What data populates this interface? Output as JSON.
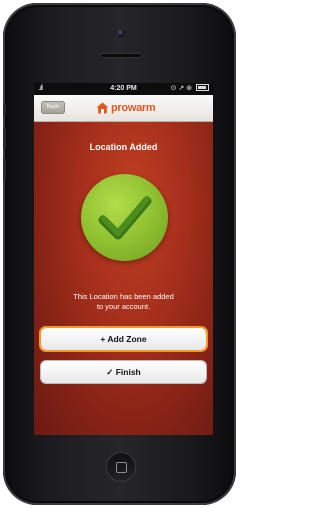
{
  "statusbar": {
    "signal": "..ıll",
    "time": "4:20 PM",
    "indicators": "⊙ ↗ ⊛"
  },
  "header": {
    "back_label": "Back",
    "logo_text": "prowarm",
    "logo_icon": "house-icon"
  },
  "main": {
    "title": "Location Added",
    "status_icon": "checkmark-icon",
    "message_line1": "This Location has been added",
    "message_line2": "to your account."
  },
  "actions": {
    "add_zone_label": "+ Add Zone",
    "finish_label": "✓ Finish"
  },
  "colors": {
    "accent": "#e0581f",
    "success": "#8fc130",
    "highlight": "#f29a27"
  }
}
